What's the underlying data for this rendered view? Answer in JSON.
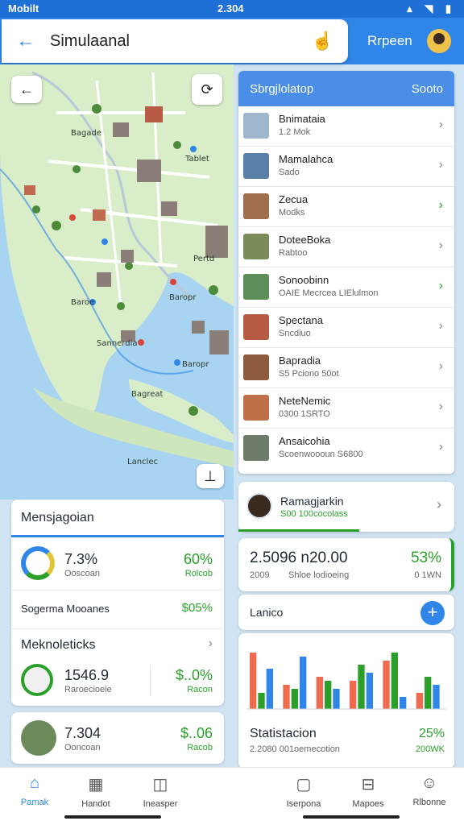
{
  "status": {
    "carrier": "Mobilt",
    "time": "2.304",
    "icons": "wifi signal battery"
  },
  "header": {
    "title": "Simulaanal",
    "profile_label": "Rrpeen"
  },
  "map": {
    "labels": [
      "Bagade",
      "Tablet",
      "Pertd",
      "Baroe",
      "Sannerdia",
      "Baropr",
      "Bagreat",
      "Lanclec"
    ]
  },
  "list": {
    "header_title": "Sbrgjlolatop",
    "header_action": "Sooto",
    "items": [
      {
        "title": "Bnimataia",
        "sub": "1.2 Mok"
      },
      {
        "title": "Mamalahca",
        "sub": "Sado"
      },
      {
        "title": "Zecua",
        "sub": "Modks"
      },
      {
        "title": "DoteeBoka",
        "sub": "Rabtoo"
      },
      {
        "title": "Sonoobinn",
        "sub": "OAIE Mecrcea LIElulmon"
      },
      {
        "title": "Spectana",
        "sub": "Sncdiuo"
      },
      {
        "title": "Bapradia",
        "sub": "S5 Pciono 50ot"
      },
      {
        "title": "NeteNemic",
        "sub": "0300 1SRTO"
      },
      {
        "title": "Ansaicohia",
        "sub": "Scoenwoooun S6800"
      }
    ]
  },
  "profile_card": {
    "name": "Ramagjarkin",
    "sub": "S00 100cocolass"
  },
  "stats_card": {
    "value": "2.5096 n20.00",
    "percent": "53%",
    "sub_left": "2009",
    "sub_mid": "Shloe lodioeing",
    "sub_right": "0 1WN"
  },
  "series_card": {
    "label": "Lanico"
  },
  "statistics_card": {
    "title": "Statistacion",
    "percent": "25%",
    "sub": "2.2080 001oemecotion",
    "sub_right": "200WK",
    "chart_data": {
      "type": "bar",
      "series": [
        {
          "values": [
            70,
            30,
            40,
            35,
            60,
            20
          ]
        },
        {
          "values": [
            20,
            25,
            35,
            55,
            70,
            40
          ]
        },
        {
          "values": [
            50,
            65,
            25,
            45,
            15,
            30
          ]
        }
      ]
    }
  },
  "left_card": {
    "title": "Mensjagoian",
    "donut_value": "7.3%",
    "donut_label": "Ooscoan",
    "percent": "60%",
    "percent_label": "Rolcob",
    "row_label": "Sogerma Mooanes",
    "row_value": "$05%",
    "section_title": "Meknoleticks",
    "stat_value": "1546.9",
    "stat_label": "Raroecioeie",
    "stat_right": "$..0%",
    "stat_right_label": "Racon"
  },
  "left_card2": {
    "value": "7.304",
    "label": "Ooncoan",
    "right": "$..06",
    "right_label": "Racob"
  },
  "nav": [
    {
      "label": "Pamak",
      "icon": "home-icon"
    },
    {
      "label": "Handot",
      "icon": "grid-icon"
    },
    {
      "label": "Ineasper",
      "icon": "inbox-icon"
    },
    {
      "label": "Iserpona",
      "icon": "file-icon"
    },
    {
      "label": "Mapoes",
      "icon": "map-icon"
    },
    {
      "label": "Rlbonne",
      "icon": "users-icon"
    }
  ]
}
